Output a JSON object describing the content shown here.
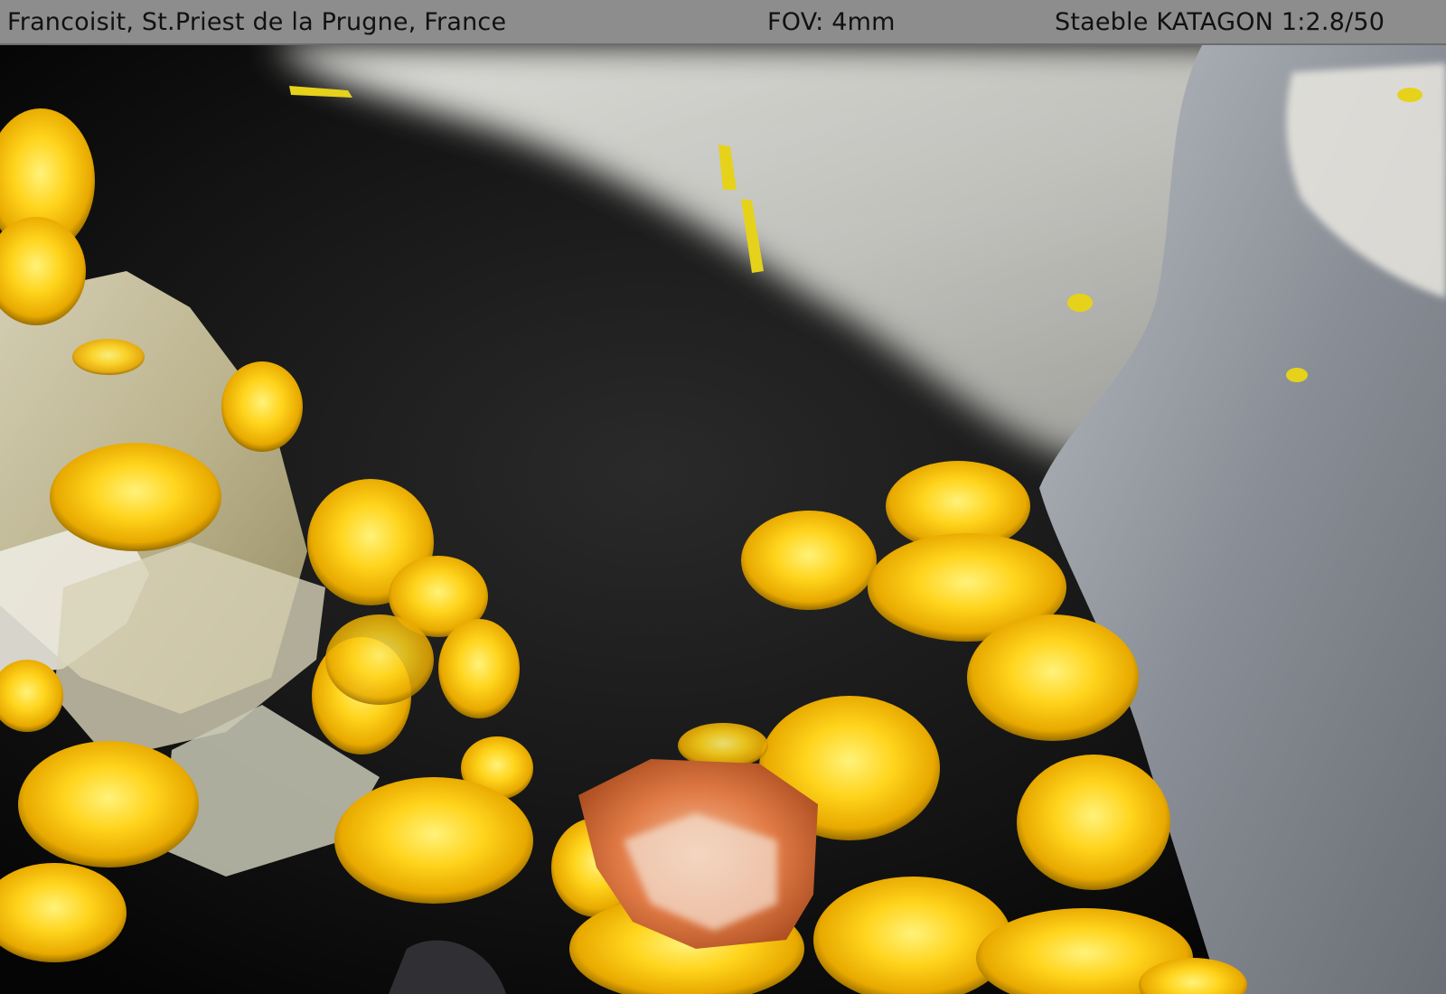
{
  "caption": {
    "specimen": "Francoisit, St.Priest de la Prugne, France",
    "fov": "FOV:  4mm",
    "lens": "Staeble KATAGON 1:2.8/50"
  },
  "colors": {
    "caption_bar": "#8d8d8d",
    "caption_text": "#111111",
    "crystal_yellow": "#ffd21a",
    "matrix_black": "#141414",
    "quartz_white": "#d9d9d4",
    "rock_gray": "#8a8f97",
    "iron_orange": "#e07a45"
  }
}
